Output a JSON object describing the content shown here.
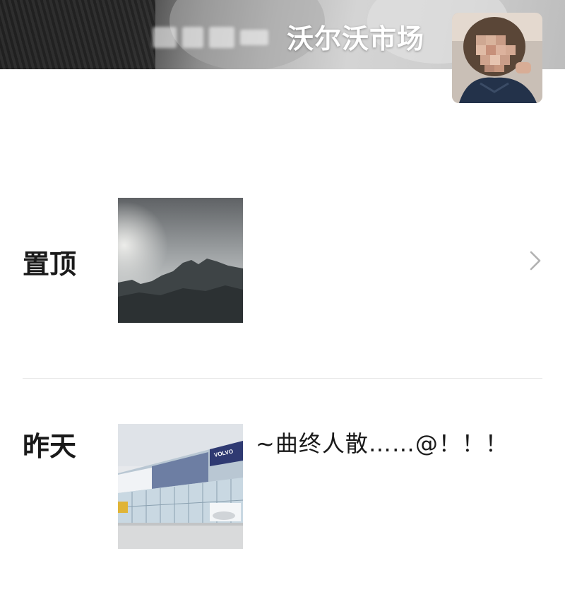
{
  "profile": {
    "nickname": "沃尔沃市场",
    "avatar_icon": "profile-avatar-photo"
  },
  "sections": [
    {
      "label": "置顶",
      "photo_icon": "mountain-silhouette-photo",
      "caption": "",
      "has_chevron": true
    },
    {
      "label": "昨天",
      "photo_icon": "volvo-dealership-photo",
      "caption": "~曲终人散……@！！！"
    }
  ],
  "icons": {
    "chevron": "chevron-right-icon"
  },
  "colors": {
    "text": "#1a1a1a",
    "chevron": "#b2b2b2",
    "divider": "#e6e6e6",
    "nickname": "#ffffff"
  }
}
